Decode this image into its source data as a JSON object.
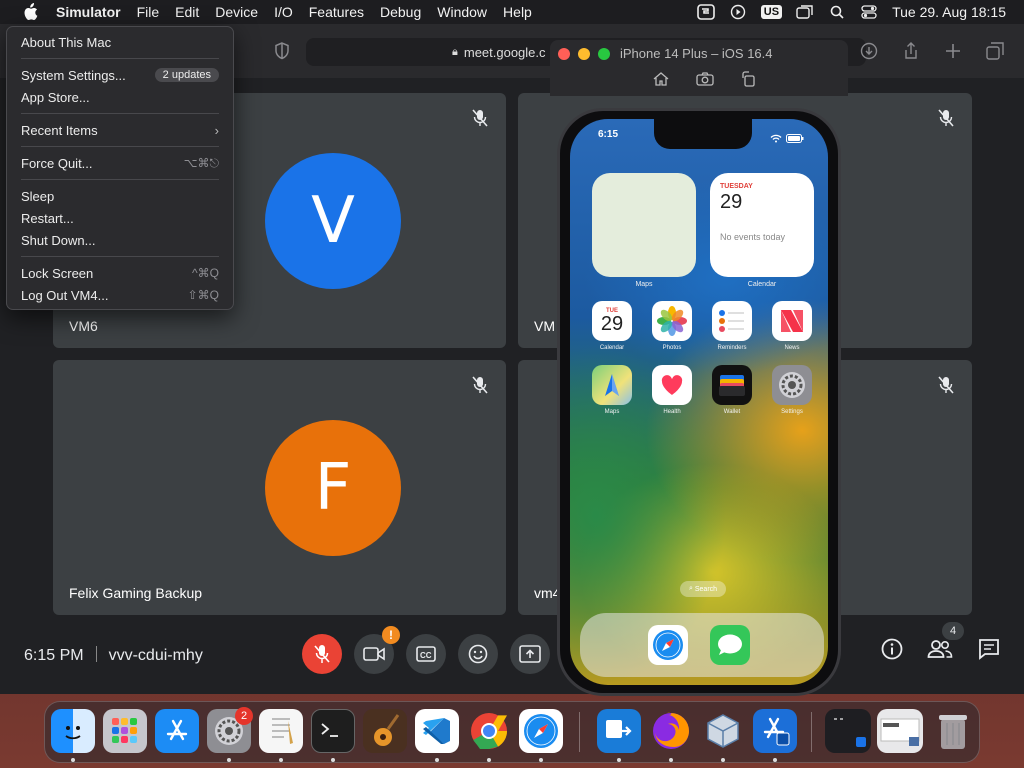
{
  "menubar": {
    "app_name": "Simulator",
    "menus": [
      "File",
      "Edit",
      "Device",
      "I/O",
      "Features",
      "Debug",
      "Window",
      "Help"
    ],
    "input_source": "US",
    "clock": "Tue 29. Aug  18:15"
  },
  "apple_menu": {
    "about": "About This Mac",
    "system_settings": "System Settings...",
    "updates_badge": "2 updates",
    "app_store": "App Store...",
    "recent_items": "Recent Items",
    "force_quit": "Force Quit...",
    "force_quit_shortcut": "⌥⌘⎋",
    "sleep": "Sleep",
    "restart": "Restart...",
    "shut_down": "Shut Down...",
    "lock_screen": "Lock Screen",
    "lock_shortcut": "^⌘Q",
    "log_out": "Log Out VM4...",
    "log_out_shortcut": "⇧⌘Q"
  },
  "browser": {
    "url": "meet.google.c"
  },
  "meet": {
    "tiles": [
      {
        "name": "VM6",
        "initial": "V",
        "color": "#1a73e8"
      },
      {
        "name": "VM",
        "initial": "",
        "color": "#3c4043"
      },
      {
        "name": "Felix Gaming Backup",
        "initial": "F",
        "color": "#e8710a"
      },
      {
        "name": "vm4",
        "initial": "",
        "color": "#3c4043"
      }
    ],
    "time": "6:15 PM",
    "meeting_code": "vvv-cdui-mhy",
    "camera_warning": "!",
    "people_count": "4",
    "colors": {
      "mic_off": "#ea4335",
      "warning": "#f28b20"
    }
  },
  "simulator": {
    "title": "iPhone 14 Plus – iOS 16.4",
    "status_time": "6:15",
    "widgets": {
      "maps_label": "Maps",
      "calendar_label": "Calendar",
      "calendar_day": "TUESDAY",
      "calendar_date": "29",
      "calendar_empty": "No events today"
    },
    "apps_row1": [
      {
        "label": "Calendar",
        "icon": "calendar-icon"
      },
      {
        "label": "Photos",
        "icon": "photos-icon"
      },
      {
        "label": "Reminders",
        "icon": "reminders-icon"
      },
      {
        "label": "News",
        "icon": "news-icon"
      }
    ],
    "apps_row2": [
      {
        "label": "Maps",
        "icon": "maps-icon"
      },
      {
        "label": "Health",
        "icon": "health-icon"
      },
      {
        "label": "Wallet",
        "icon": "wallet-icon"
      },
      {
        "label": "Settings",
        "icon": "settings-icon"
      }
    ],
    "calendar_app_day": "TUE",
    "calendar_app_date": "29",
    "search_label": "Search",
    "dock": [
      "Safari",
      "Messages"
    ]
  },
  "dock": {
    "apps": [
      "Finder",
      "Launchpad",
      "App Store",
      "System Settings",
      "TextEdit",
      "Terminal",
      "GarageBand",
      "Visual Studio Code",
      "Chrome",
      "Safari",
      "Screens",
      "Firefox",
      "VirtualBox",
      "Simulator"
    ],
    "settings_badge": "2"
  }
}
